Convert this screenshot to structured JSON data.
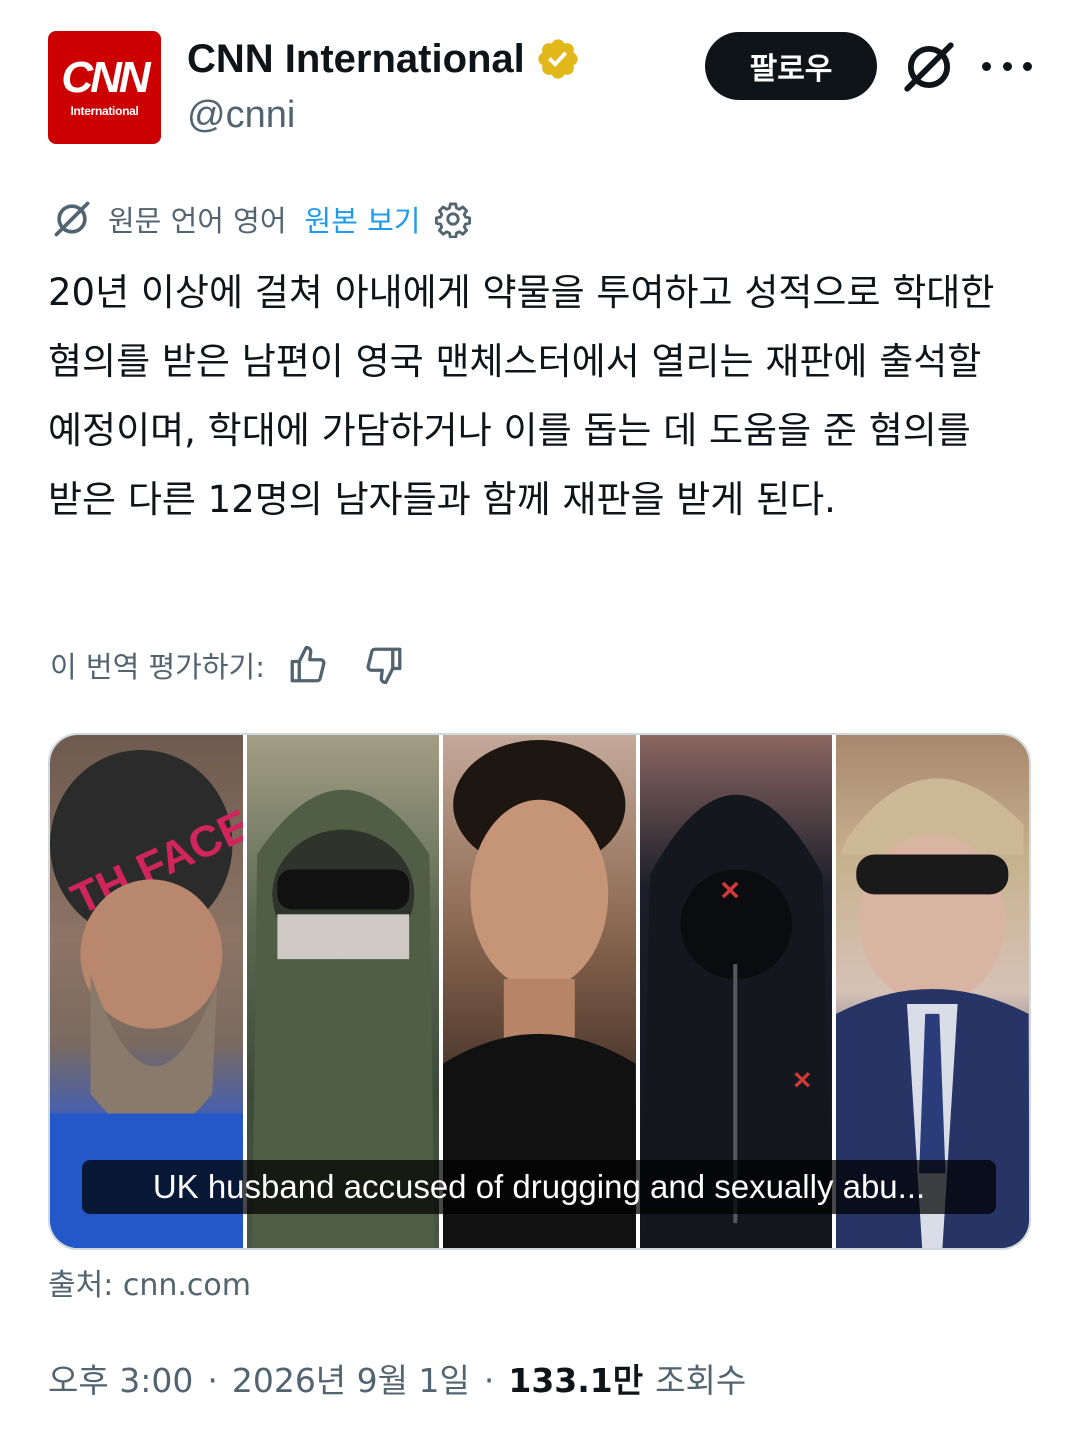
{
  "author": {
    "logo_text": "CNN",
    "logo_sub": "International",
    "display_name": "CNN International",
    "handle": "@cnni",
    "verified": true,
    "verified_color": "#e2b719",
    "logo_color": "#cc0000"
  },
  "actions": {
    "follow_label": "팔로우",
    "grok_icon": "grok-icon",
    "more_icon": "more-icon"
  },
  "translation": {
    "label": "원문 언어 영어",
    "link": "원본 보기",
    "link_color": "#1d9bf0"
  },
  "tweet": {
    "text": "20년 이상에 걸쳐 아내에게 약물을 투여하고 성적으로 학대한 혐의를 받은 남편이 영국 맨체스터에서 열리는 재판에 출석할 예정이며, 학대에 가담하거나 이를 돕는 데 도움을 준 혐의를 받은 다른 12명의 남자들과 함께 재판을 받게 된다."
  },
  "rate": {
    "label": "이 번역 평가하기:"
  },
  "card": {
    "caption": "UK husband accused of drugging and sexually abu...",
    "source": "출처: cnn.com"
  },
  "meta": {
    "time": "오후 3:00",
    "separator": "·",
    "date": "2026년 9월 1일",
    "views": "133.1만",
    "views_label": "조회수"
  }
}
